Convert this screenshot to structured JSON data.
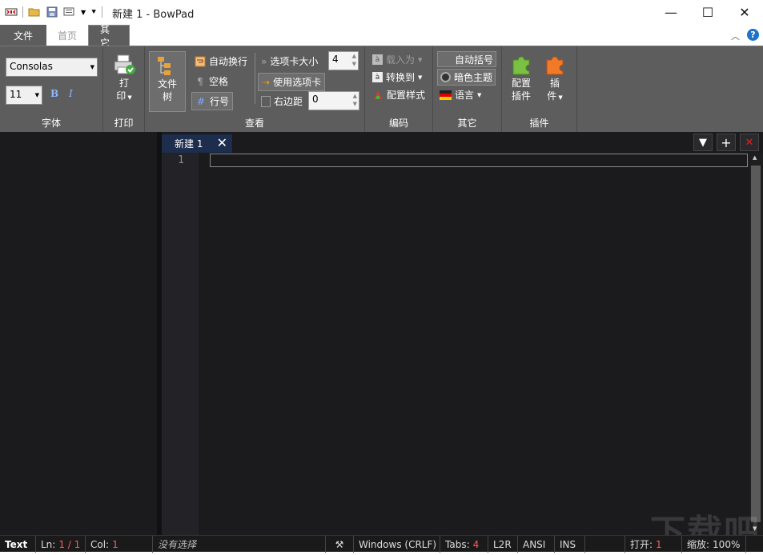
{
  "window": {
    "title": "新建 1 - BowPad"
  },
  "menu_tabs": [
    "文件",
    "首页",
    "其它"
  ],
  "font": {
    "name": "Consolas",
    "size": "11",
    "bold": "B",
    "italic": "I",
    "group_label": "字体"
  },
  "print": {
    "label_line1": "打",
    "label_line2": "印",
    "group_label": "打印"
  },
  "view": {
    "file_tree_line1": "文件",
    "file_tree_line2": "树",
    "word_wrap": "自动换行",
    "whitespace": "空格",
    "line_numbers": "行号",
    "tab_size_label": "选项卡大小",
    "tab_size_value": "4",
    "use_tabs": "使用选项卡",
    "right_margin_label": "右边距",
    "right_margin_value": "0",
    "group_label": "查看"
  },
  "encoding": {
    "load_as": "载入为",
    "convert_to": "转换到",
    "config_style": "配置样式",
    "group_label": "编码"
  },
  "other": {
    "auto_brace": "自动括号",
    "dark_theme": "暗色主题",
    "language": "语言",
    "group_label": "其它"
  },
  "plugins": {
    "config_line1": "配置",
    "config_line2": "插件",
    "plugin_line1": "插",
    "plugin_line2": "件",
    "group_label": "插件"
  },
  "editor": {
    "tab_title": "新建 1",
    "tab_close": "✕",
    "line_number": "1",
    "tab_dropdown": "▼",
    "tab_add": "+",
    "tab_close_all": "✕"
  },
  "status": {
    "lexer": "Text",
    "ln_label": "Ln:",
    "ln_value": "1 / 1",
    "col_label": "Col:",
    "col_value": "1",
    "selection": "没有选择",
    "eol": "Windows (CRLF)",
    "tabs_label": "Tabs:",
    "tabs_value": "4",
    "direction": "L2R",
    "encoding": "ANSI",
    "ins": "INS",
    "open_label": "打开:",
    "open_value": "1",
    "zoom_label": "缩放:",
    "zoom_value": "100%"
  },
  "watermark": "下载吧"
}
